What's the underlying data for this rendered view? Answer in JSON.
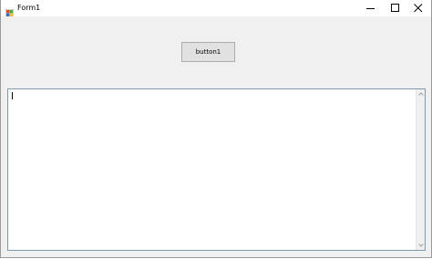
{
  "window": {
    "title": "Form1",
    "app_icon": "winforms-app-icon",
    "controls": {
      "minimize_icon": "minimize-icon",
      "maximize_icon": "maximize-icon",
      "close_icon": "close-icon"
    }
  },
  "form": {
    "button_label": "button1",
    "textbox_value": "",
    "textbox_scrollbar": "vertical"
  },
  "colors": {
    "client_background": "#f0f0f0",
    "button_face": "#e1e1e1",
    "button_border": "#adadad",
    "textbox_border": "#7a9bb0",
    "titlebar_background": "#ffffff"
  }
}
